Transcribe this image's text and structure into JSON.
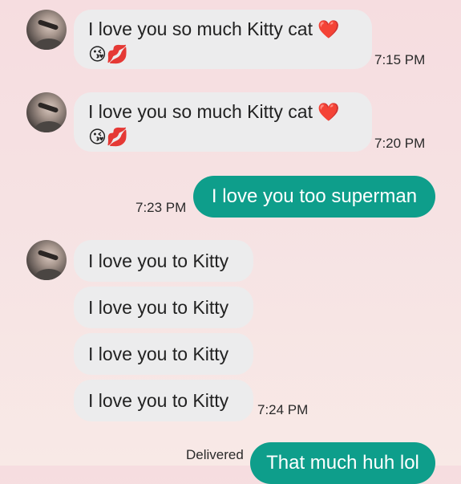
{
  "messages": [
    {
      "text": "I love you so much Kitty cat",
      "heart": "❤️",
      "emojis": "😘💋",
      "time": "7:15 PM"
    },
    {
      "text": "I love you so much Kitty cat",
      "heart": "❤️",
      "emojis": "😘💋",
      "time": "7:20 PM"
    },
    {
      "text": "I love you too superman",
      "time": "7:23 PM"
    },
    {
      "text": "I love you to Kitty"
    },
    {
      "text": "I love you to Kitty"
    },
    {
      "text": "I love you to Kitty"
    },
    {
      "text": "I love you to Kitty",
      "time": "7:24 PM"
    },
    {
      "text": "That much huh lol",
      "status": "Delivered"
    }
  ],
  "colors": {
    "outgoing_bubble": "#0e9e8b",
    "incoming_bubble": "#ececed"
  }
}
